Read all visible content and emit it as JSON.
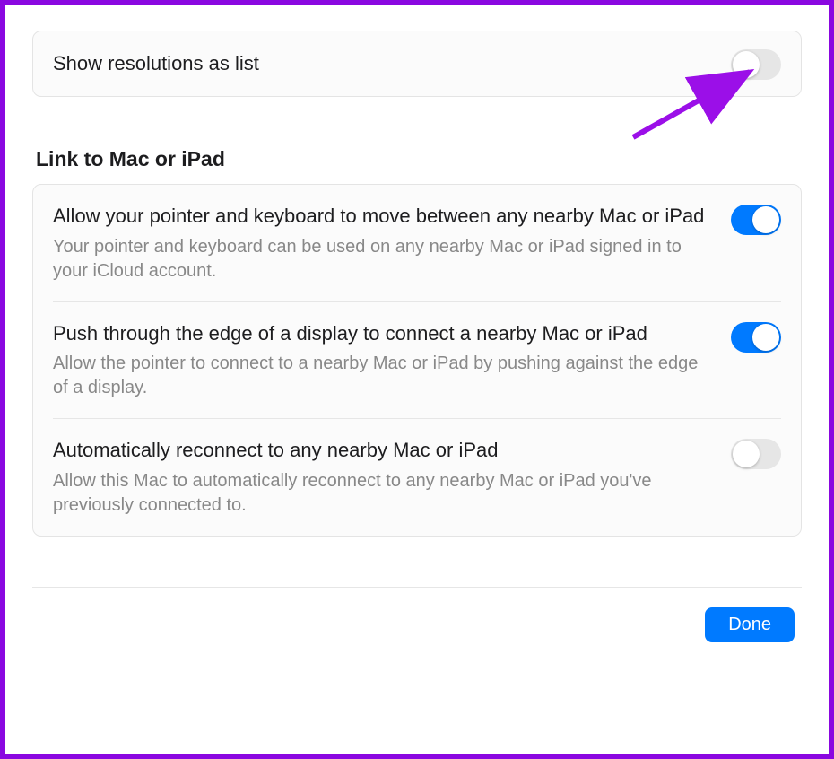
{
  "top_card": {
    "show_resolutions_label": "Show resolutions as list",
    "show_resolutions_on": false
  },
  "section_title": "Link to Mac or iPad",
  "link_card": {
    "items": [
      {
        "title": "Allow your pointer and keyboard to move between any nearby Mac or iPad",
        "desc": "Your pointer and keyboard can be used on any nearby Mac or iPad signed in to your iCloud account.",
        "on": true
      },
      {
        "title": "Push through the edge of a display to connect a nearby Mac or iPad",
        "desc": "Allow the pointer to connect to a nearby Mac or iPad by pushing against the edge of a display.",
        "on": true
      },
      {
        "title": "Automatically reconnect to any nearby Mac or iPad",
        "desc": "Allow this Mac to automatically reconnect to any nearby Mac or iPad you've previously connected to.",
        "on": false
      }
    ]
  },
  "footer": {
    "done_label": "Done"
  },
  "annotation": {
    "arrow_color": "#9b0fe8"
  }
}
